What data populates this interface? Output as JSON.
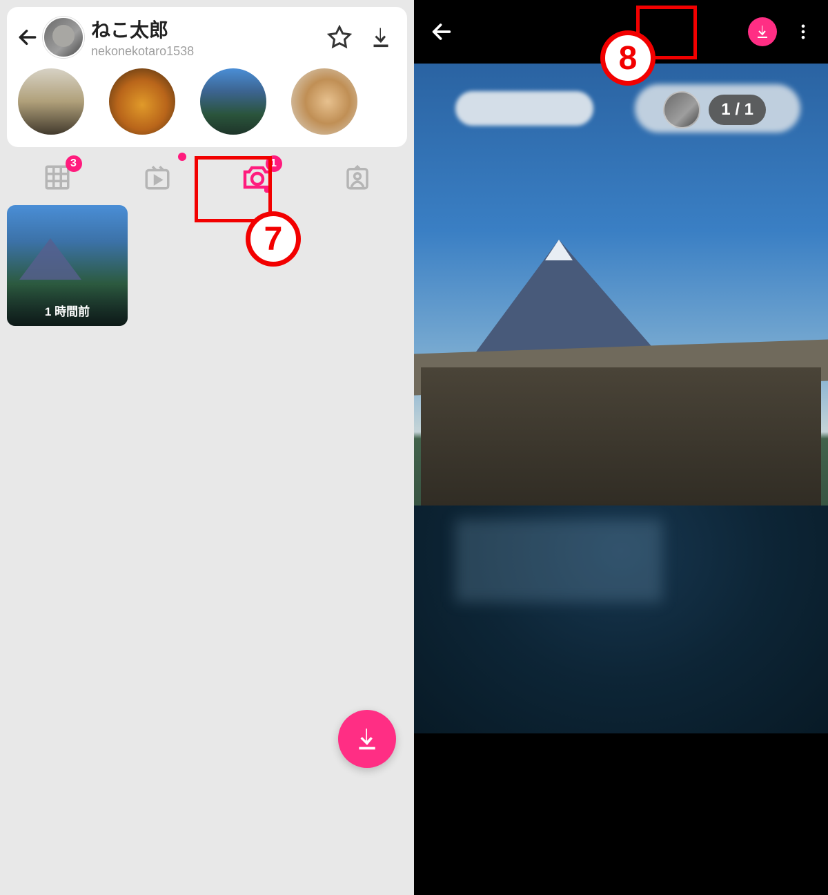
{
  "left": {
    "user": {
      "display_name": "ねこ太郎",
      "username": "nekonekotaro1538"
    },
    "header_icons": {
      "back": "back-arrow-icon",
      "favorite": "star-outline-icon",
      "download": "download-icon"
    },
    "story_highlights": [
      {
        "name": "highlight-1"
      },
      {
        "name": "highlight-2"
      },
      {
        "name": "highlight-3"
      },
      {
        "name": "highlight-4"
      }
    ],
    "tabs": {
      "grid_badge": "3",
      "reels_dot": true,
      "camera_badge": "1"
    },
    "posts": [
      {
        "timestamp": "1 時間前"
      }
    ],
    "fab_icon": "download-icon",
    "annotation": {
      "marker": "7"
    }
  },
  "right": {
    "header_icons": {
      "back": "back-arrow-icon",
      "download": "download-icon",
      "more": "more-vert-icon"
    },
    "counter": "1 / 1",
    "annotation": {
      "marker": "8"
    }
  },
  "colors": {
    "accent": "#ff2e84",
    "annotation_red": "#f20000"
  }
}
